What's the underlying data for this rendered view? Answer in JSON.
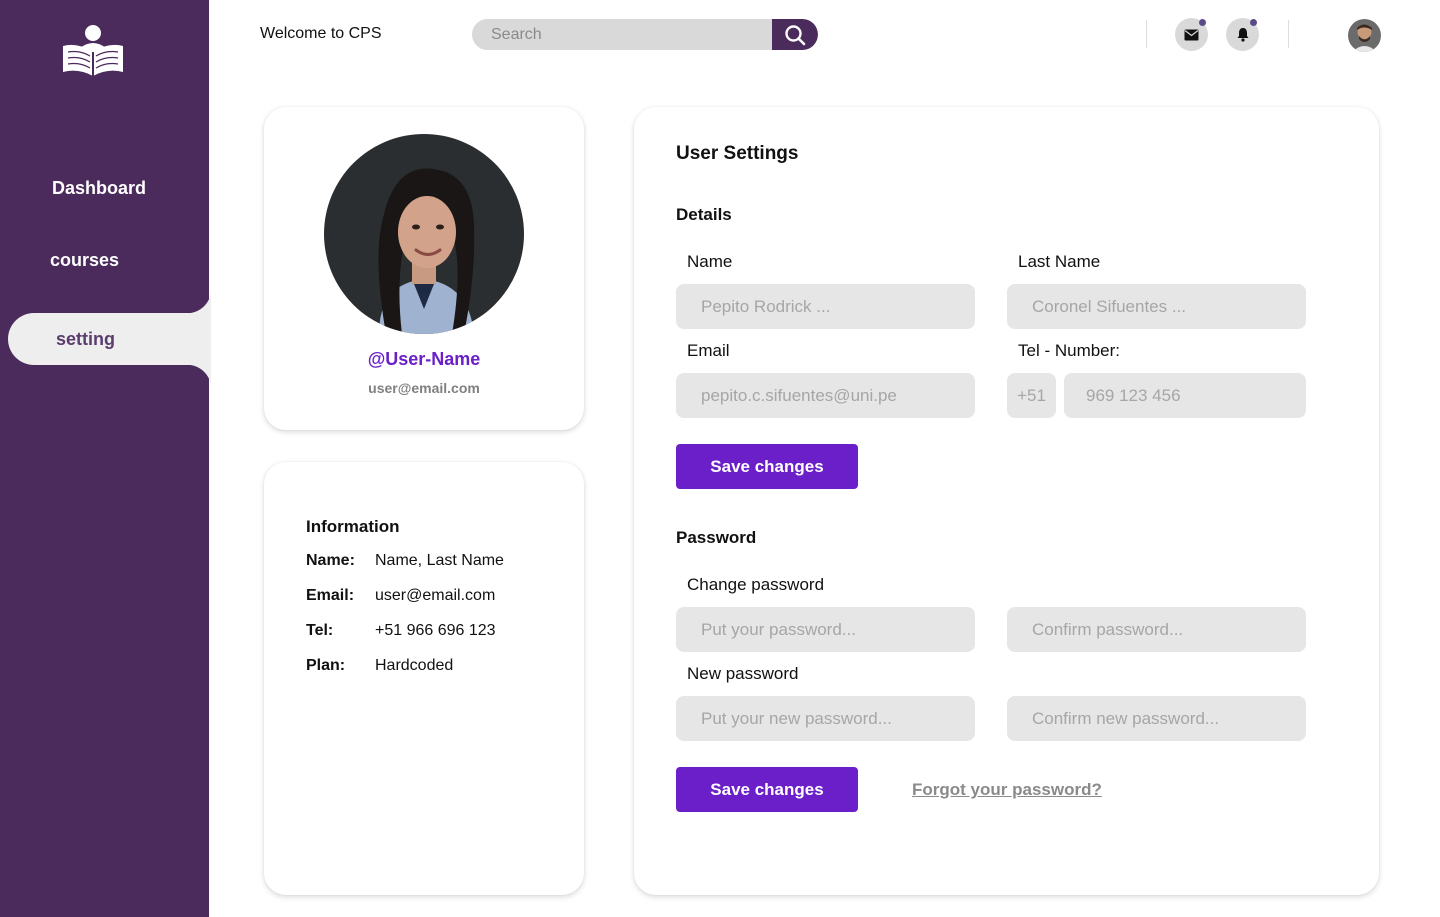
{
  "app": {
    "welcome": "Welcome to CPS"
  },
  "search": {
    "placeholder": "Search"
  },
  "sidebar": {
    "items": [
      {
        "label": "Dashboard"
      },
      {
        "label": "courses"
      },
      {
        "label": "setting",
        "active": true
      }
    ]
  },
  "profile": {
    "username": "@User-Name",
    "email": "user@email.com"
  },
  "information": {
    "title": "Information",
    "rows": [
      {
        "key": "Name:",
        "value": "Name, Last Name"
      },
      {
        "key": "Email:",
        "value": "user@email.com"
      },
      {
        "key": "Tel:",
        "value": "+51 966 696 123"
      },
      {
        "key": "Plan:",
        "value": "Hardcoded"
      }
    ]
  },
  "settings": {
    "title": "User Settings",
    "details": {
      "heading": "Details",
      "name_label": "Name",
      "name_placeholder": "Pepito Rodrick ...",
      "lastname_label": "Last Name",
      "lastname_placeholder": "Coronel Sifuentes ...",
      "email_label": "Email",
      "email_placeholder": "pepito.c.sifuentes@uni.pe",
      "tel_label": "Tel - Number:",
      "tel_prefix": "+51",
      "tel_placeholder": "969 123 456",
      "save_label": "Save changes"
    },
    "password": {
      "heading": "Password",
      "change_label": "Change password",
      "current_placeholder": "Put your password...",
      "confirm_placeholder": "Confirm password...",
      "new_label": "New password",
      "new_placeholder": "Put your new password...",
      "confirm_new_placeholder": "Confirm new password...",
      "save_label": "Save changes",
      "forgot_label": "Forgot your password?"
    }
  },
  "colors": {
    "sidebar": "#4b2a5c",
    "accent": "#6a1fc9",
    "input_bg": "#e6e6e6",
    "notification_dot": "#5b4a8a"
  },
  "icons": [
    "book-reader-logo-icon",
    "search-icon",
    "mail-icon",
    "bell-icon"
  ]
}
